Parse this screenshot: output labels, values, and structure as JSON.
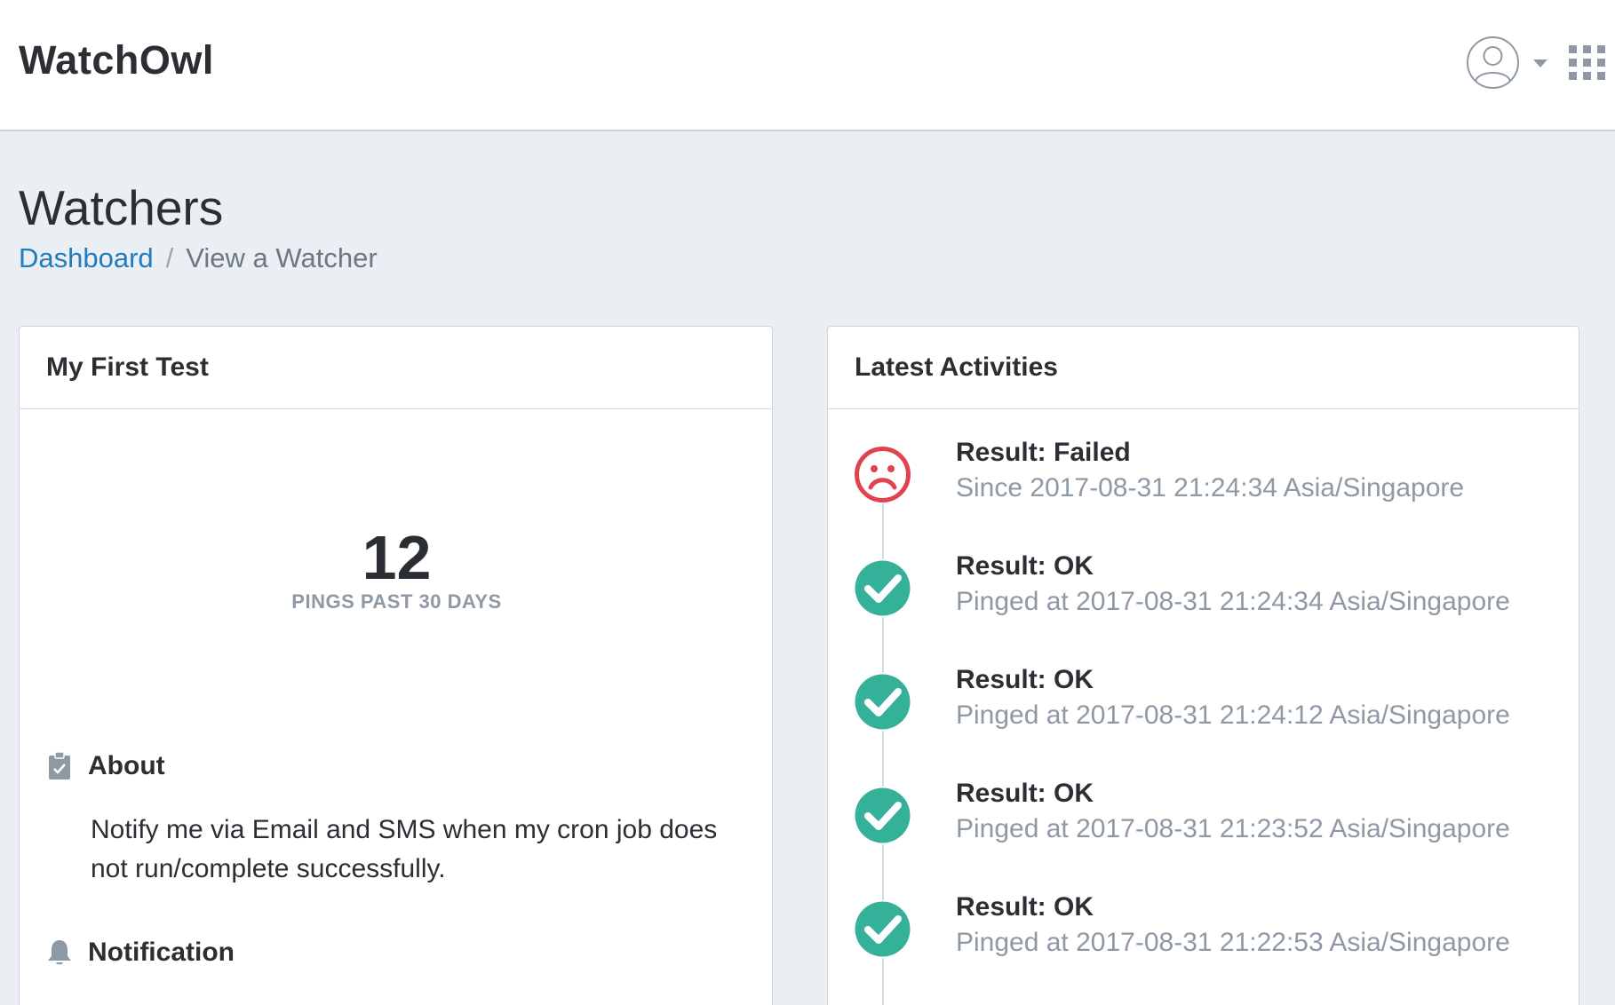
{
  "app": {
    "brand": "WatchOwl"
  },
  "header": {
    "user_icon": "user-circle-icon",
    "menu_caret_icon": "caret-down-icon",
    "apps_icon": "grid-dots-icon"
  },
  "page": {
    "title": "Watchers",
    "breadcrumb": {
      "home": "Dashboard",
      "separator": "/",
      "current": "View a Watcher"
    }
  },
  "watcher": {
    "name": "My First Test",
    "pings_count": "12",
    "pings_label": "PINGS PAST 30 DAYS",
    "about_title": "About",
    "about_icon": "clipboard-check-icon",
    "about_text": "Notify me via Email and SMS when my cron job does not run/complete successfully.",
    "notification_title": "Notification",
    "notification_icon": "bell-icon"
  },
  "activities": {
    "title": "Latest Activities",
    "colors": {
      "failed": "#e04250",
      "ok": "#35b19a"
    },
    "items": [
      {
        "status": "failed",
        "icon": "sad-face-icon",
        "title": "Result: Failed",
        "detail": "Since 2017-08-31 21:24:34 Asia/Singapore"
      },
      {
        "status": "ok",
        "icon": "check-circle-icon",
        "title": "Result: OK",
        "detail": "Pinged at 2017-08-31 21:24:34 Asia/Singapore"
      },
      {
        "status": "ok",
        "icon": "check-circle-icon",
        "title": "Result: OK",
        "detail": "Pinged at 2017-08-31 21:24:12 Asia/Singapore"
      },
      {
        "status": "ok",
        "icon": "check-circle-icon",
        "title": "Result: OK",
        "detail": "Pinged at 2017-08-31 21:23:52 Asia/Singapore"
      },
      {
        "status": "ok",
        "icon": "check-circle-icon",
        "title": "Result: OK",
        "detail": "Pinged at 2017-08-31 21:22:53 Asia/Singapore"
      }
    ]
  }
}
